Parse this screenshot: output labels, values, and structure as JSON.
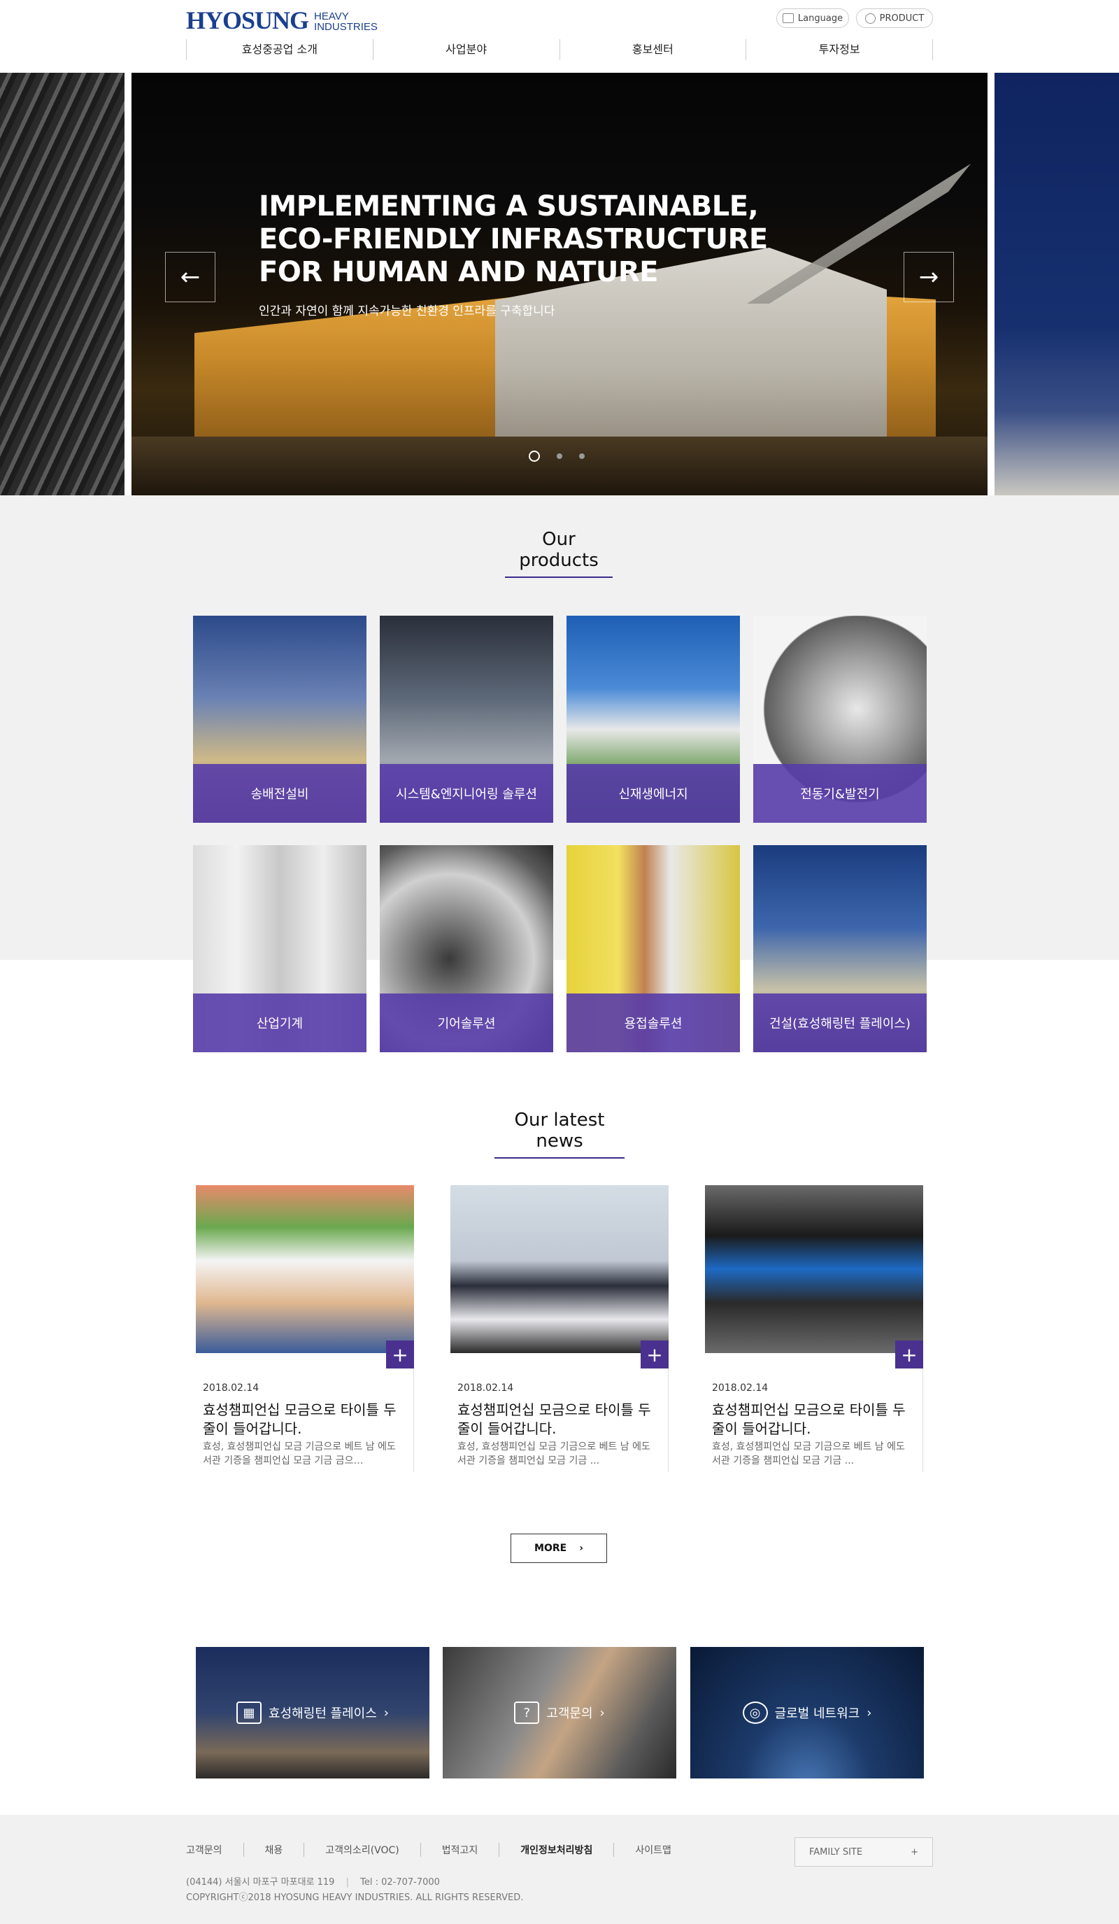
{
  "header": {
    "logo_main": "HYOSUNG",
    "logo_sub_1": "HEAVY",
    "logo_sub_2": "INDUSTRIES",
    "language_label": "Language",
    "product_label": "PRODUCT",
    "nav": [
      "효성중공업 소개",
      "사업분야",
      "홍보센터",
      "투자정보"
    ]
  },
  "hero": {
    "title_line_1": "IMPLEMENTING A SUSTAINABLE,",
    "title_line_2": "ECO-FRIENDLY INFRASTRUCTURE",
    "title_line_3": "FOR HUMAN AND NATURE",
    "subtitle": "인간과 자연이 함께 지속가능한 친환경 인프라를 구축합니다",
    "prev_icon": "arrow-left-icon",
    "next_icon": "arrow-right-icon",
    "slide_count": 3,
    "active_slide": 1
  },
  "products": {
    "title": "Our products",
    "items": [
      {
        "label": "송배전설비"
      },
      {
        "label": "시스템&엔지니어링 솔루션"
      },
      {
        "label": "신재생에너지"
      },
      {
        "label": "전동기&발전기"
      },
      {
        "label": "산업기계"
      },
      {
        "label": "기어솔루션"
      },
      {
        "label": "용접솔루션"
      },
      {
        "label": "건설(효성해링턴 플레이스)"
      }
    ]
  },
  "news": {
    "title": "Our latest news",
    "items": [
      {
        "date": "2018.02.14",
        "title": "효성챔피언십 모금으로 타이틀 두 줄이 들어갑니다.",
        "excerpt": "효성, 효성챔피언십 모금 기금으로 베트 남 에도서관 기증을 챔피언십 모금 기금 금으…"
      },
      {
        "date": "2018.02.14",
        "title": "효성챔피언십 모금으로 타이틀 두 줄이 들어갑니다.",
        "excerpt": "효성, 효성챔피언십 모금 기금으로 베트 남 에도서관 기증을 챔피언십 모금 기금 ..."
      },
      {
        "date": "2018.02.14",
        "title": "효성챔피언십 모금으로 타이틀 두 줄이 들어갑니다.",
        "excerpt": "효성, 효성챔피언십 모금 기금으로 베트 남 에도서관 기증을 챔피언십 모금 기금 ..."
      }
    ],
    "plus_icon": "plus-icon",
    "more_label": "MORE"
  },
  "banners": [
    {
      "label": "효성해링턴 플레이스",
      "icon": "building-icon"
    },
    {
      "label": "고객문의",
      "icon": "question-bubble-icon"
    },
    {
      "label": "글로벌 네트워크",
      "icon": "globe-icon"
    }
  ],
  "footer": {
    "links": [
      "고객문의",
      "채용",
      "고객의소리(VOC)",
      "법적고지",
      "개인정보처리방침",
      "사이트맵"
    ],
    "family_site": "FAMILY SITE",
    "address": "(04144) 서울시 마포구 마포대로 119",
    "tel": "Tel : 02-707-7000",
    "copyright": "COPYRIGHTⓒ2018 HYOSUNG HEAVY INDUSTRIES. ALL RIGHTS RESERVED."
  },
  "colors": {
    "brand_blue": "#1a3f8f",
    "accent_purple": "#4a318f",
    "product_label_bg": "#583caa"
  }
}
